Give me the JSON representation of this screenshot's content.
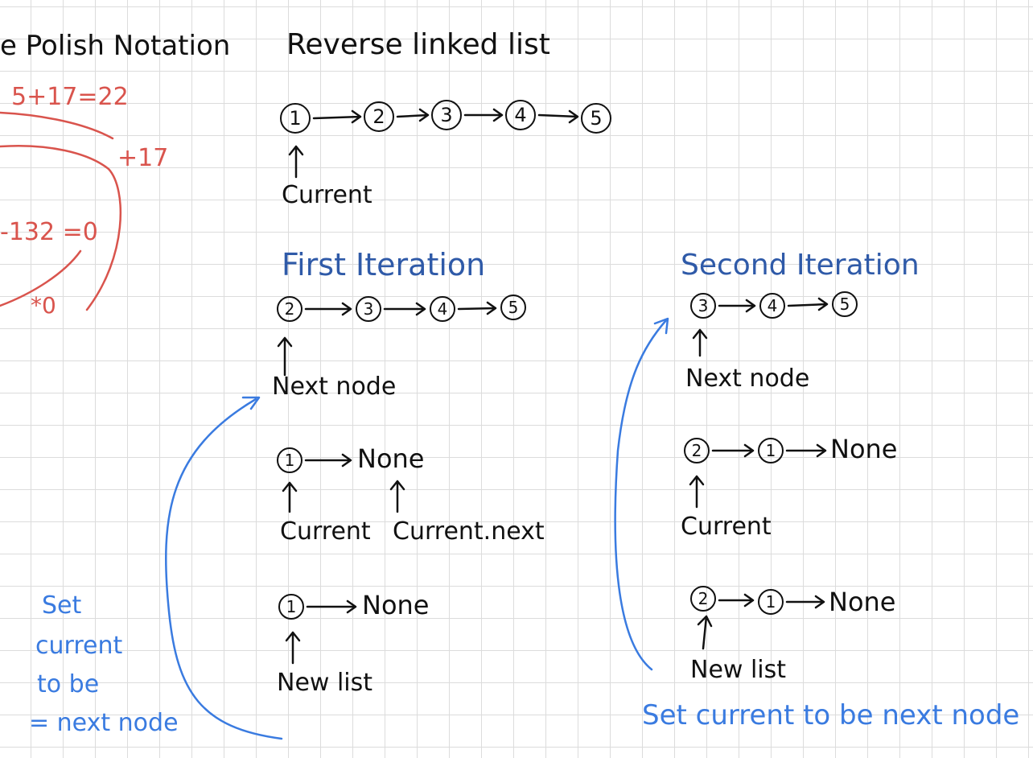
{
  "rpn": {
    "title": "e Polish Notation",
    "expr1": "5+17=22",
    "plus17": "+17",
    "expr2": "-132 =0",
    "times0": "*0",
    "color": "#d9544d"
  },
  "title": "Reverse linked list",
  "initial": {
    "nodes": [
      "1",
      "2",
      "3",
      "4",
      "5"
    ],
    "current_label": "Current"
  },
  "first": {
    "heading": "First Iteration",
    "row1": {
      "nodes": [
        "2",
        "3",
        "4",
        "5"
      ],
      "label": "Next node"
    },
    "row2": {
      "node": "1",
      "tail": "None",
      "label_a": "Current",
      "label_b": "Current.next"
    },
    "row3": {
      "node": "1",
      "tail": "None",
      "label": "New list"
    }
  },
  "second": {
    "heading": "Second Iteration",
    "row1": {
      "nodes": [
        "3",
        "4",
        "5"
      ],
      "label": "Next node"
    },
    "row2": {
      "nodes": [
        "2",
        "1"
      ],
      "tail": "None",
      "label": "Current"
    },
    "row3": {
      "nodes": [
        "2",
        "1"
      ],
      "tail": "None",
      "label": "New list"
    }
  },
  "notes": {
    "left": [
      "Set",
      "current",
      "to be",
      "= next node"
    ],
    "bottom": "Set current to be next node",
    "color": "#3a7be0"
  }
}
